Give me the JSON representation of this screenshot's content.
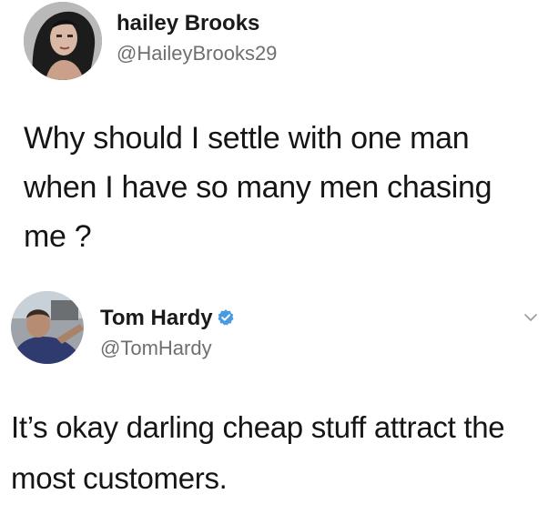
{
  "tweets": [
    {
      "display_name": "hailey Brooks",
      "handle": "@HaileyBrooks29",
      "verified": false,
      "text_lines": [
        "Why should I settle with one man",
        "when I have so many men chasing",
        "me ?"
      ],
      "avatar_icon": "profile-photo-woman"
    },
    {
      "display_name": "Tom Hardy",
      "handle": "@TomHardy",
      "verified": true,
      "verified_color": "#4a9ae1",
      "text_lines": [
        "It’s okay darling cheap stuff attract the",
        "most customers."
      ],
      "avatar_icon": "profile-photo-man",
      "menu_icon": "chevron-down-icon"
    }
  ]
}
